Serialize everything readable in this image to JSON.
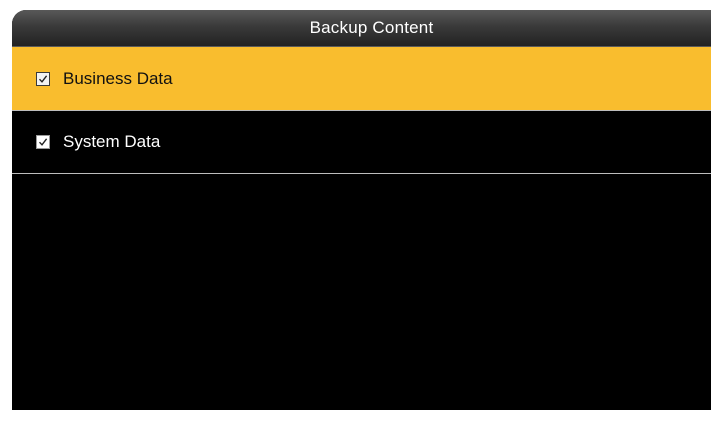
{
  "header": {
    "title": "Backup Content"
  },
  "menu": {
    "items": [
      {
        "label": "Business Data",
        "checked": true,
        "selected": true
      },
      {
        "label": "System Data",
        "checked": true,
        "selected": false
      }
    ]
  },
  "colors": {
    "background": "#000000",
    "selected_row": "#f9bd2e",
    "title_bar": "#3a3a3a",
    "text": "#ffffff"
  },
  "icons": {
    "checkbox": "checkbox-checked-icon"
  }
}
